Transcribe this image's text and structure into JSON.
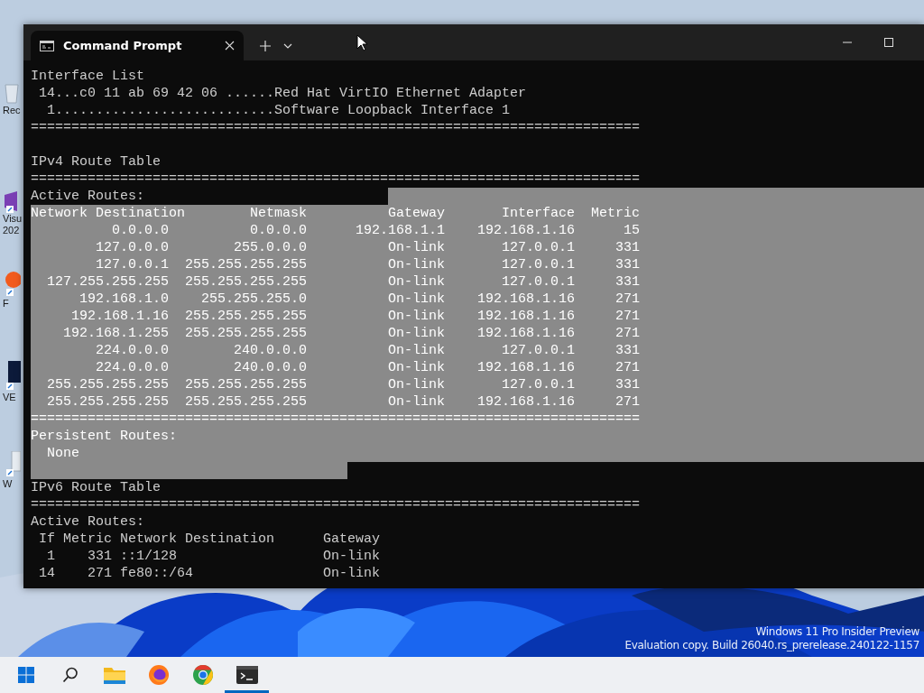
{
  "window": {
    "tab_title": "Command Prompt"
  },
  "terminal": {
    "lines": [
      {
        "kind": "text",
        "text": "Interface List",
        "selected": false
      },
      {
        "kind": "text",
        "text": " 14...c0 11 ab 69 42 06 ......Red Hat VirtIO Ethernet Adapter",
        "selected": false
      },
      {
        "kind": "text",
        "text": "  1...........................Software Loopback Interface 1",
        "selected": false
      },
      {
        "kind": "text",
        "text": "===========================================================================",
        "selected": false
      },
      {
        "kind": "text",
        "selected": false
      },
      {
        "kind": "text",
        "text": "IPv4 Route Table",
        "selected": false
      },
      {
        "kind": "text",
        "text": "===========================================================================",
        "selected": false
      },
      {
        "kind": "text",
        "text": "Active Routes:",
        "selected": true,
        "partial": true
      },
      {
        "kind": "route-header",
        "cells": [
          "Network Destination",
          "Netmask",
          "Gateway",
          "Interface",
          "Metric"
        ],
        "selected": true
      },
      {
        "kind": "route",
        "cells": [
          "0.0.0.0",
          "0.0.0.0",
          "192.168.1.1",
          "192.168.1.16",
          "15"
        ],
        "selected": true
      },
      {
        "kind": "route",
        "cells": [
          "127.0.0.0",
          "255.0.0.0",
          "On-link",
          "127.0.0.1",
          "331"
        ],
        "selected": true
      },
      {
        "kind": "route",
        "cells": [
          "127.0.0.1",
          "255.255.255.255",
          "On-link",
          "127.0.0.1",
          "331"
        ],
        "selected": true
      },
      {
        "kind": "route",
        "cells": [
          "127.255.255.255",
          "255.255.255.255",
          "On-link",
          "127.0.0.1",
          "331"
        ],
        "selected": true
      },
      {
        "kind": "route",
        "cells": [
          "192.168.1.0",
          "255.255.255.0",
          "On-link",
          "192.168.1.16",
          "271"
        ],
        "selected": true
      },
      {
        "kind": "route",
        "cells": [
          "192.168.1.16",
          "255.255.255.255",
          "On-link",
          "192.168.1.16",
          "271"
        ],
        "selected": true
      },
      {
        "kind": "route",
        "cells": [
          "192.168.1.255",
          "255.255.255.255",
          "On-link",
          "192.168.1.16",
          "271"
        ],
        "selected": true
      },
      {
        "kind": "route",
        "cells": [
          "224.0.0.0",
          "240.0.0.0",
          "On-link",
          "127.0.0.1",
          "331"
        ],
        "selected": true
      },
      {
        "kind": "route",
        "cells": [
          "224.0.0.0",
          "240.0.0.0",
          "On-link",
          "192.168.1.16",
          "271"
        ],
        "selected": true
      },
      {
        "kind": "route",
        "cells": [
          "255.255.255.255",
          "255.255.255.255",
          "On-link",
          "127.0.0.1",
          "331"
        ],
        "selected": true
      },
      {
        "kind": "route",
        "cells": [
          "255.255.255.255",
          "255.255.255.255",
          "On-link",
          "192.168.1.16",
          "271"
        ],
        "selected": true
      },
      {
        "kind": "text",
        "text": "===========================================================================",
        "selected": true
      },
      {
        "kind": "text",
        "text": "Persistent Routes:",
        "selected": true
      },
      {
        "kind": "text",
        "text": "  None",
        "selected": true
      },
      {
        "kind": "text",
        "selected": true,
        "partial": true
      },
      {
        "kind": "text",
        "text": "IPv6 Route Table",
        "selected": false
      },
      {
        "kind": "text",
        "text": "===========================================================================",
        "selected": false
      },
      {
        "kind": "text",
        "text": "Active Routes:",
        "selected": false
      },
      {
        "kind": "text",
        "text": " If Metric Network Destination      Gateway",
        "selected": false
      },
      {
        "kind": "text",
        "text": "  1    331 ::1/128                  On-link",
        "selected": false
      },
      {
        "kind": "text",
        "text": " 14    271 fe80::/64                On-link",
        "selected": false
      }
    ]
  },
  "desktop_icons": [
    {
      "kind": "recycle",
      "label": "Rec"
    },
    {
      "kind": "studio",
      "label": "Visu 202"
    },
    {
      "kind": "browser",
      "label": "F"
    },
    {
      "kind": "video",
      "label": "VE"
    },
    {
      "kind": "file",
      "label": "W"
    }
  ],
  "watermark": [
    "Windows 11 Pro Insider Preview",
    "Evaluation copy. Build 26040.rs_prerelease.240122-1157"
  ],
  "taskbar": {
    "items": [
      {
        "kind": "start",
        "selected": false
      },
      {
        "kind": "search",
        "selected": false
      },
      {
        "kind": "folder",
        "selected": false
      },
      {
        "kind": "firefox",
        "selected": false
      },
      {
        "kind": "chrome",
        "selected": false
      },
      {
        "kind": "terminal",
        "selected": true
      }
    ]
  }
}
